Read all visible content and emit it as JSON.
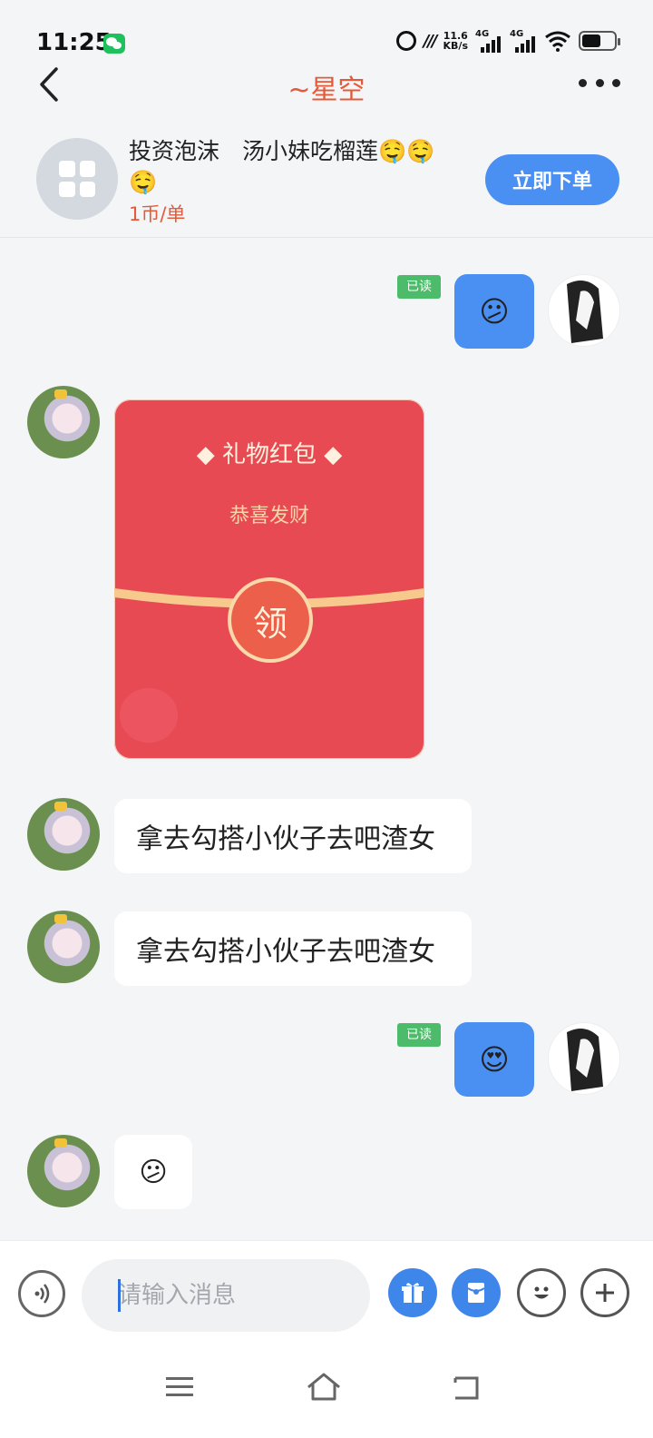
{
  "status_bar": {
    "time": "11:25",
    "net_speed_value": "11.6",
    "net_speed_unit": "KB/s",
    "signal1_label": "4G",
    "signal2_label": "4G"
  },
  "header": {
    "title": "~星空",
    "back_icon": "back-arrow-icon",
    "more_icon": "more-dots-icon"
  },
  "product": {
    "title": "投资泡沫　汤小妹吃榴莲🤤🤤🤤",
    "price": "1币/单",
    "order_button": "立即下单"
  },
  "messages": [
    {
      "side": "right",
      "type": "emoji",
      "text": "😕",
      "read_label": "已读"
    },
    {
      "side": "left",
      "type": "red_packet",
      "title": "礼物红包",
      "subtitle": "恭喜发财",
      "button": "领"
    },
    {
      "side": "left",
      "type": "text",
      "text": "拿去勾搭小伙子去吧渣女"
    },
    {
      "side": "left",
      "type": "text",
      "text": "拿去勾搭小伙子去吧渣女"
    },
    {
      "side": "right",
      "type": "emoji",
      "text": "😍",
      "read_label": "已读"
    },
    {
      "side": "left",
      "type": "emoji",
      "text": "😕"
    }
  ],
  "input_bar": {
    "placeholder": "请输入消息",
    "icons": [
      "voice-icon",
      "gift-icon",
      "red-packet-icon",
      "emoji-icon",
      "plus-icon"
    ]
  },
  "nav_bar": {
    "icons": [
      "menu-icon",
      "home-icon",
      "back-icon"
    ]
  },
  "colors": {
    "accent_blue": "#4a8ff2",
    "title_red": "#e35a3a",
    "red_packet": "#e84a54",
    "read_badge": "#4cbb6a"
  }
}
